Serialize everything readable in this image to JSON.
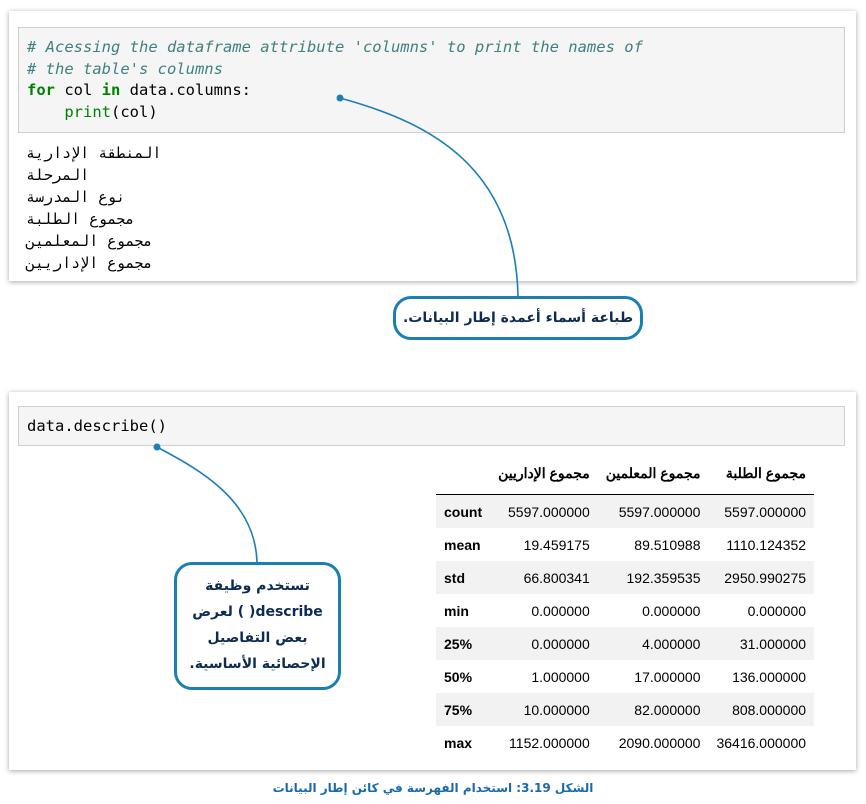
{
  "cell1": {
    "comment_line1": "# Acessing the dataframe attribute 'columns' to print the names of",
    "comment_line2": "# the table's columns",
    "kw_for": "for",
    "code_col": " col ",
    "kw_in": "in",
    "code_rest": " data.columns:",
    "indent": "    ",
    "fn_print": "print",
    "print_args": "(col)"
  },
  "output_lines": [
    "المنطقة الإدارية",
    "المرحلة",
    "نوع المدرسة",
    "مجموع الطلبة",
    "مجموع المعلمين",
    "مجموع الإداريين"
  ],
  "callout1": "طباعة أسماء أعمدة إطار البيانات.",
  "cell2": {
    "code": "data.describe()"
  },
  "describe_table": {
    "headers": [
      "",
      "مجموع الطلبة",
      "مجموع المعلمين",
      "مجموع الإداريين"
    ],
    "rows": [
      {
        "index": "count",
        "values": [
          "5597.000000",
          "5597.000000",
          "5597.000000"
        ]
      },
      {
        "index": "mean",
        "values": [
          "1110.124352",
          "89.510988",
          "19.459175"
        ]
      },
      {
        "index": "std",
        "values": [
          "2950.990275",
          "192.359535",
          "66.800341"
        ]
      },
      {
        "index": "min",
        "values": [
          "0.000000",
          "0.000000",
          "0.000000"
        ]
      },
      {
        "index": "25%",
        "values": [
          "31.000000",
          "4.000000",
          "0.000000"
        ]
      },
      {
        "index": "50%",
        "values": [
          "136.000000",
          "17.000000",
          "1.000000"
        ]
      },
      {
        "index": "75%",
        "values": [
          "808.000000",
          "82.000000",
          "10.000000"
        ]
      },
      {
        "index": "max",
        "values": [
          "36416.000000",
          "2090.000000",
          "1152.000000"
        ]
      }
    ]
  },
  "callout2_lines": [
    "تستخدم وظيفة",
    "describe( ) لعرض",
    "بعض التفاصيل",
    "الإحصائية الأساسية."
  ],
  "caption": "الشكل 3.19: استخدام الفهرسة في كائن إطار البيانات",
  "colors": {
    "accent": "#1b7fb4",
    "comment": "#408080",
    "keyword": "#008000",
    "caption": "#1b6aa8"
  }
}
